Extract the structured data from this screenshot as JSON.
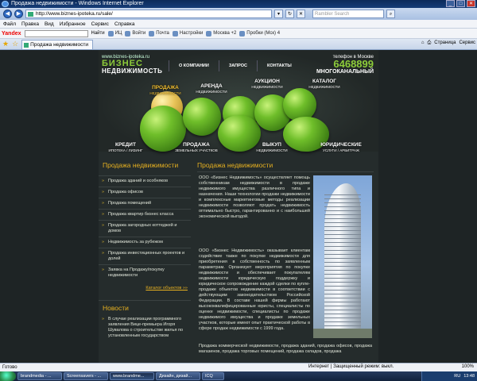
{
  "window": {
    "title": "Продажа недвижимости - Windows Internet Explorer",
    "buttons": [
      "_",
      "□",
      "✕"
    ]
  },
  "address_bar": {
    "url": "http://www.biznes-ipoteka.ru/sale/",
    "search_placeholder": "Rambler Search",
    "refresh_icon": "refresh-icon",
    "back_icon": "back-icon",
    "forward_icon": "forward-icon"
  },
  "menu": {
    "items": [
      "Файл",
      "Правка",
      "Вид",
      "Избранное",
      "Сервис",
      "Справка"
    ]
  },
  "yandex_bar": {
    "logo": "Yandex",
    "find_label": "Найти",
    "items": [
      "ИЦ",
      "Войти",
      "Почта",
      "Настройки",
      "Москва +2",
      "Пробки (Мск) 4"
    ]
  },
  "tab_bar": {
    "tab_title": "Продажа недвижимости",
    "tools": [
      "Страница",
      "Сервис"
    ]
  },
  "site": {
    "url_text": "www.biznes-ipoteka.ru",
    "brand_line1": "БИЗНЕС",
    "brand_line2": "НЕДВИЖИМОСТЬ",
    "nav": [
      "О КОМПАНИИ",
      "ЗАПРОС",
      "КОНТАКТЫ"
    ],
    "phone_label": "телефон в Москве",
    "phone_number": "6468899",
    "phone_sub": "МНОГОКАНАЛЬНЫЙ",
    "header_links": [
      {
        "title": "ПРОДАЖА",
        "sub": "НЕДВИЖИМОСТИ"
      },
      {
        "title": "АРЕНДА",
        "sub": "НЕДВИЖИМОСТИ"
      },
      {
        "title": "АУКЦИОН",
        "sub": "НЕДВИЖИМОСТИ"
      },
      {
        "title": "КАТАЛОГ",
        "sub": "НЕДВИЖИМОСТИ"
      },
      {
        "title": "КРЕДИТ",
        "sub": "ИПОТЕКА / ЛИЗИНГ"
      },
      {
        "title": "ПРОДАЖА",
        "sub": "ЗЕМЕЛЬНЫХ УЧАСТКОВ"
      },
      {
        "title": "ВЫКУП",
        "sub": "НЕДВИЖИМОСТИ"
      },
      {
        "title": "ЮРИДИЧЕСКИЕ",
        "sub": "УСЛУГИ / АРБИТРАЖ"
      }
    ]
  },
  "sidebar": {
    "heading": "Продажа недвижимости",
    "items": [
      "Продажа зданий и особняков",
      "Продажа офисов",
      "Продажа помещений",
      "Продажа квартир бизнес класса",
      "Продажа загородных коттеджей и домов",
      "Недвижимость за рубежом",
      "Продажа инвестиционных проектов и долей",
      "Заявка на Продажу/покупку недвижимости"
    ],
    "catalog_link": "Каталог объектов »»",
    "news_heading": "Новости",
    "news_item": "В случае реализации программного заявления Вице-премьера Игоря Шувалова о строительстве жилья по установленным государством"
  },
  "main": {
    "heading": "Продажа недвижимости",
    "p1": "ООО «Бизнес Недвижимость» осуществляет помощь собственникам недвижимости в продаже недвижимого имущества различного типа и назначения. Наши технологии продажи недвижимости и комплексные маркетинговые методы реализации недвижимости позволяют продать недвижимость оптимально быстро, гарантированно и с наибольшей экономической выгодой.",
    "p2": "ООО «Бизнес Недвижимость» оказывает клиентам содействие также по покупке недвижимости для приобретения в собственность по заявленным параметрам. Организует мероприятия по покупке недвижимости и обеспечивает покупателям недвижимости юридическую поддержку и юридическое сопровождение каждой сделки по купле-продаже объектов недвижимости в соответствии с действующим законодательством Российской Федерации. В составе нашей фирмы работают высококвалифицированные юристы, специалисты по оценке недвижимости, специалисты по продаже недвижимого имущества и продаже земельных участков, которые имеют опыт практической работы в сфере продаж недвижимости с 1999 года.",
    "p3": "Продажа коммерческой недвижимости, продажа зданий, продажа офисов, продажа магазинов, продажа торговых помещений, продажа складов, продажа"
  },
  "status_bar": {
    "left": "Готово",
    "zone": "Интернет | Защищенный режим: выкл.",
    "zoom": "100%"
  },
  "taskbar": {
    "items": [
      "brandmedia - ...",
      "Screensavers - ...",
      "www.brandme...",
      "Дизайн, дизай...",
      "ICQ"
    ],
    "lang": "RU",
    "clock": "13:48"
  }
}
